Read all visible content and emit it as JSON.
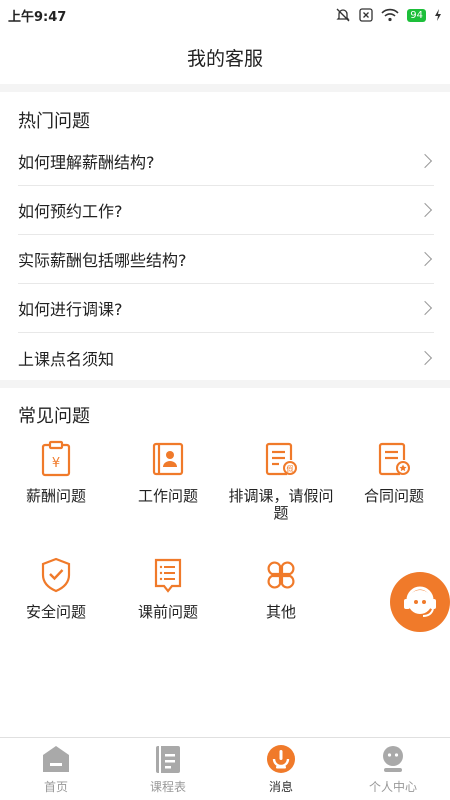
{
  "status": {
    "time": "上午9:47",
    "battery": "94"
  },
  "header": {
    "title": "我的客服"
  },
  "hot": {
    "title": "热门问题",
    "items": [
      {
        "label": "如何理解薪酬结构?"
      },
      {
        "label": "如何预约工作?"
      },
      {
        "label": "实际薪酬包括哪些结构?"
      },
      {
        "label": "如何进行调课?"
      },
      {
        "label": "上课点名须知"
      }
    ]
  },
  "common": {
    "title": "常见问题",
    "items": [
      {
        "label": "薪酬问题",
        "icon": "salary-clipboard-icon"
      },
      {
        "label": "工作问题",
        "icon": "contact-book-icon"
      },
      {
        "label": "排调课，请假问题",
        "icon": "leave-document-icon"
      },
      {
        "label": "合同问题",
        "icon": "contract-star-icon"
      },
      {
        "label": "安全问题",
        "icon": "shield-check-icon"
      },
      {
        "label": "课前问题",
        "icon": "lesson-list-icon"
      },
      {
        "label": "其他",
        "icon": "four-leaf-icon"
      }
    ]
  },
  "tabs": [
    {
      "label": "首页",
      "icon": "home-icon"
    },
    {
      "label": "课程表",
      "icon": "schedule-icon"
    },
    {
      "label": "消息",
      "icon": "message-icon",
      "active": true
    },
    {
      "label": "个人中心",
      "icon": "profile-icon"
    }
  ],
  "colors": {
    "accent": "#f07a2a",
    "tab_inactive": "#a9a9a9"
  }
}
